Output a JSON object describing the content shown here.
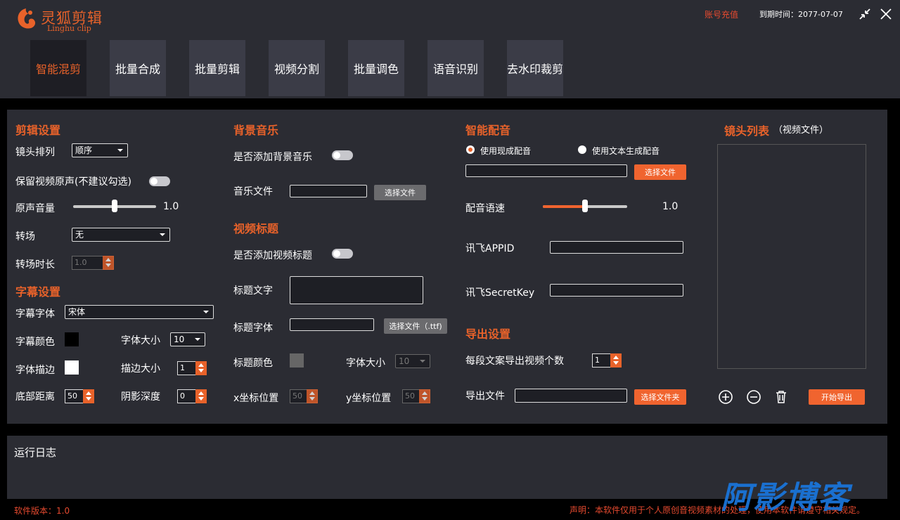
{
  "app": {
    "title": "灵狐剪辑",
    "subtitle": "Linghu clip"
  },
  "header": {
    "recharge": "账号充值",
    "expiry": "到期时间：2077-07-07"
  },
  "tabs": [
    {
      "label": "智能混剪",
      "active": true
    },
    {
      "label": "批量合成"
    },
    {
      "label": "批量剪辑"
    },
    {
      "label": "视频分割"
    },
    {
      "label": "批量调色"
    },
    {
      "label": "语音识别"
    },
    {
      "label": "去水印裁剪"
    }
  ],
  "edit": {
    "title": "剪辑设置",
    "lens_order_label": "镜头排列",
    "lens_order_value": "顺序",
    "keep_audio_label": "保留视频原声(不建议勾选)",
    "keep_audio_on": false,
    "orig_volume_label": "原声音量",
    "orig_volume_value": "1.0",
    "orig_volume_level": 0.5,
    "transition_label": "转场",
    "transition_value": "无",
    "transition_duration_label": "转场时长",
    "transition_duration_value": "1.0"
  },
  "subtitle": {
    "title": "字幕设置",
    "font_label": "字幕字体",
    "font_value": "宋体",
    "color_label": "字幕颜色",
    "color_value": "#000000",
    "size_label": "字体大小",
    "size_value": "10",
    "stroke_label": "字体描边",
    "stroke_color": "#ffffff",
    "stroke_size_label": "描边大小",
    "stroke_size_value": "1",
    "bottom_label": "底部距离",
    "bottom_value": "50",
    "shadow_label": "阴影深度",
    "shadow_value": "0"
  },
  "music": {
    "title": "背景音乐",
    "add_label": "是否添加背景音乐",
    "add_on": false,
    "file_label": "音乐文件",
    "file_value": "",
    "select_button": "选择文件"
  },
  "video_title": {
    "title": "视频标题",
    "add_label": "是否添加视频标题",
    "add_on": false,
    "text_label": "标题文字",
    "text_value": "",
    "font_label": "标题字体",
    "font_value": "",
    "font_button": "选择文件（.ttf)",
    "color_label": "标题颜色",
    "color_value": "#666666",
    "size_label": "字体大小",
    "size_value": "10",
    "x_label": "x坐标位置",
    "x_value": "50",
    "y_label": "y坐标位置",
    "y_value": "50"
  },
  "dubbing": {
    "title": "智能配音",
    "radio_existing": "使用现成配音",
    "radio_tts": "使用文本生成配音",
    "selected": "existing",
    "file_value": "",
    "select_button": "选择文件",
    "speed_label": "配音语速",
    "speed_value": "1.0",
    "speed_level": 0.5,
    "appid_label": "讯飞APPID",
    "appid_value": "",
    "secret_label": "讯飞SecretKey",
    "secret_value": ""
  },
  "export": {
    "title": "导出设置",
    "count_label": "每段文案导出视频个数",
    "count_value": "1",
    "file_label": "导出文件",
    "file_value": "",
    "folder_button": "选择文件夹"
  },
  "lens_list": {
    "title": "镜头列表",
    "hint": "（视频文件）",
    "add_icon": "plus-circle-icon",
    "remove_icon": "minus-circle-icon",
    "delete_icon": "trash-icon",
    "start_button": "开始导出"
  },
  "log": {
    "title": "运行日志"
  },
  "footer": {
    "version": "软件版本：1.0",
    "notice": "声明：本软件仅用于个人原创音视频素材的处理，使用本软件请遵守相关规定。"
  },
  "watermark": "阿影博客",
  "colors": {
    "accent": "#e8622a",
    "panel": "#2b2c33",
    "background": "#000000",
    "tab": "#3b3c47"
  }
}
